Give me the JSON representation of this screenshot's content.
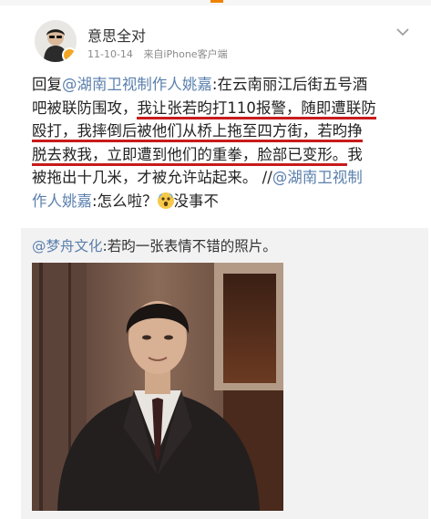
{
  "user": {
    "name": "意思全对",
    "time": "11-10-14",
    "client": "来自iPhone客户端"
  },
  "post": {
    "lines": [
      [
        {
          "t": "回复",
          "s": "plain"
        },
        {
          "t": "@湖南卫视制作人姚嘉",
          "s": "link"
        },
        {
          "t": ":在云南丽江后街五号酒",
          "s": "plain"
        }
      ],
      [
        {
          "t": "吧被联防围攻，",
          "s": "plain"
        },
        {
          "t": "我让张若昀打110报警，随即遭联防",
          "s": "red"
        }
      ],
      [
        {
          "t": "殴打，我摔倒后被他们从桥上拖至四方街，若昀挣",
          "s": "red"
        }
      ],
      [
        {
          "t": "脱去救我，立即遭到他们的重拳，脸部已变形。",
          "s": "red"
        },
        {
          "t": "我",
          "s": "plain"
        }
      ],
      [
        {
          "t": "被拖出十几米，才被允许站起来。 //",
          "s": "plain"
        },
        {
          "t": "@湖南卫视制",
          "s": "link"
        }
      ],
      [
        {
          "t": "作人姚嘉",
          "s": "link"
        },
        {
          "t": ":怎么啦？",
          "s": "plain"
        },
        {
          "t": "",
          "s": "emoji"
        },
        {
          "t": "没事不",
          "s": "plain"
        }
      ]
    ]
  },
  "repost": {
    "author": "@梦舟文化",
    "text": ":若昀一张表情不错的照片。"
  },
  "colors": {
    "link": "#5a7fad",
    "underline": "#c81b1b",
    "repost_bg": "#f2f2f2",
    "accent": "#f08200"
  },
  "icons": {
    "more": "chevron-down-icon",
    "verified": "verified-badge-icon",
    "emoji": "shocked-face-emoji-icon"
  }
}
